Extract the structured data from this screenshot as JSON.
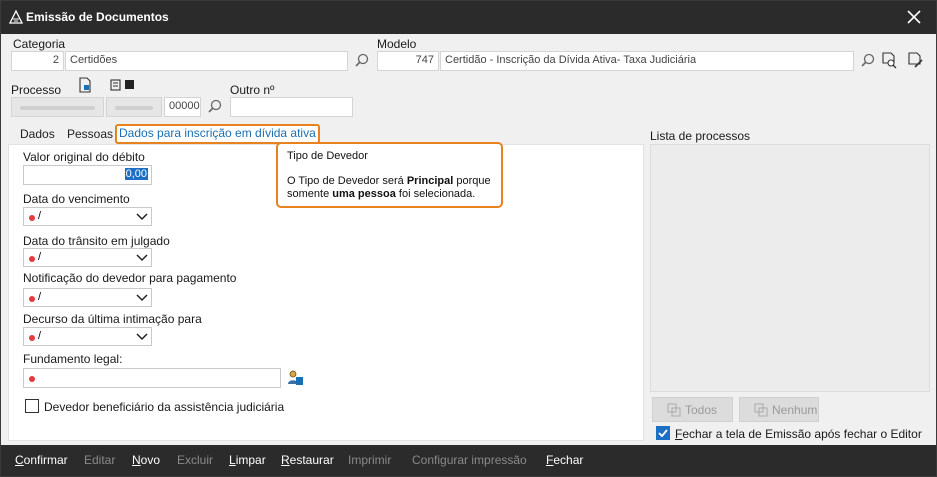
{
  "window": {
    "title": "Emissão de Documentos"
  },
  "categoria": {
    "label": "Categoria",
    "code": "2",
    "name": "Certidões"
  },
  "modelo": {
    "label": "Modelo",
    "code": "747",
    "name": "Certidão - Inscrição da Dívida Ativa- Taxa Judiciária"
  },
  "processo": {
    "label": "Processo",
    "suffix": "00000"
  },
  "outro": {
    "label": "Outro nº",
    "value": ""
  },
  "tabs": [
    {
      "label": "Dados"
    },
    {
      "label": "Pessoas"
    },
    {
      "label": "Dados para inscrição em dívida ativa"
    }
  ],
  "form": {
    "valor_label": "Valor original do débito",
    "valor_value": "0,00",
    "vencimento_label": "Data do vencimento",
    "transito_label": "Data do trânsito em julgado",
    "notificacao_label": "Notificação do devedor para pagamento",
    "decurso_label": "Decurso da última intimação para",
    "fundamento_label": "Fundamento legal:",
    "date_sep": "/",
    "beneficiario_label": "Devedor beneficiário da assistência judiciária"
  },
  "tooltip": {
    "title": "Tipo de Devedor",
    "line1_pre": "O Tipo de Devedor será ",
    "line1_bold": "Principal",
    "line1_post": " porque",
    "line2_pre": "somente ",
    "line2_bold": "uma pessoa",
    "line2_post": " foi selecionada."
  },
  "lista": {
    "label": "Lista de processos",
    "todos": "Todos",
    "nenhum": "Nenhum",
    "fechar_label_u": "F",
    "fechar_label_rest": "echar a tela de Emissão após fechar o Editor",
    "fechar_checked": true
  },
  "actions": [
    {
      "u": "C",
      "rest": "onfirmar",
      "enabled": true
    },
    {
      "u": "",
      "rest": "Editar",
      "enabled": false
    },
    {
      "u": "N",
      "rest": "ovo",
      "enabled": true
    },
    {
      "u": "",
      "rest": "Excluir",
      "enabled": false
    },
    {
      "u": "L",
      "rest": "impar",
      "enabled": true
    },
    {
      "u": "R",
      "rest": "estaurar",
      "enabled": true
    },
    {
      "u": "",
      "rest": "Imprimir",
      "enabled": false
    },
    {
      "u": "",
      "rest": "Configurar impressão",
      "enabled": false
    },
    {
      "u": "F",
      "rest": "echar",
      "enabled": true
    }
  ],
  "colors": {
    "accent": "#e8821e",
    "link": "#1a6fb3",
    "titlebar": "#2b2b2b",
    "required": "#e23b3b",
    "check": "#1c6fc4"
  }
}
